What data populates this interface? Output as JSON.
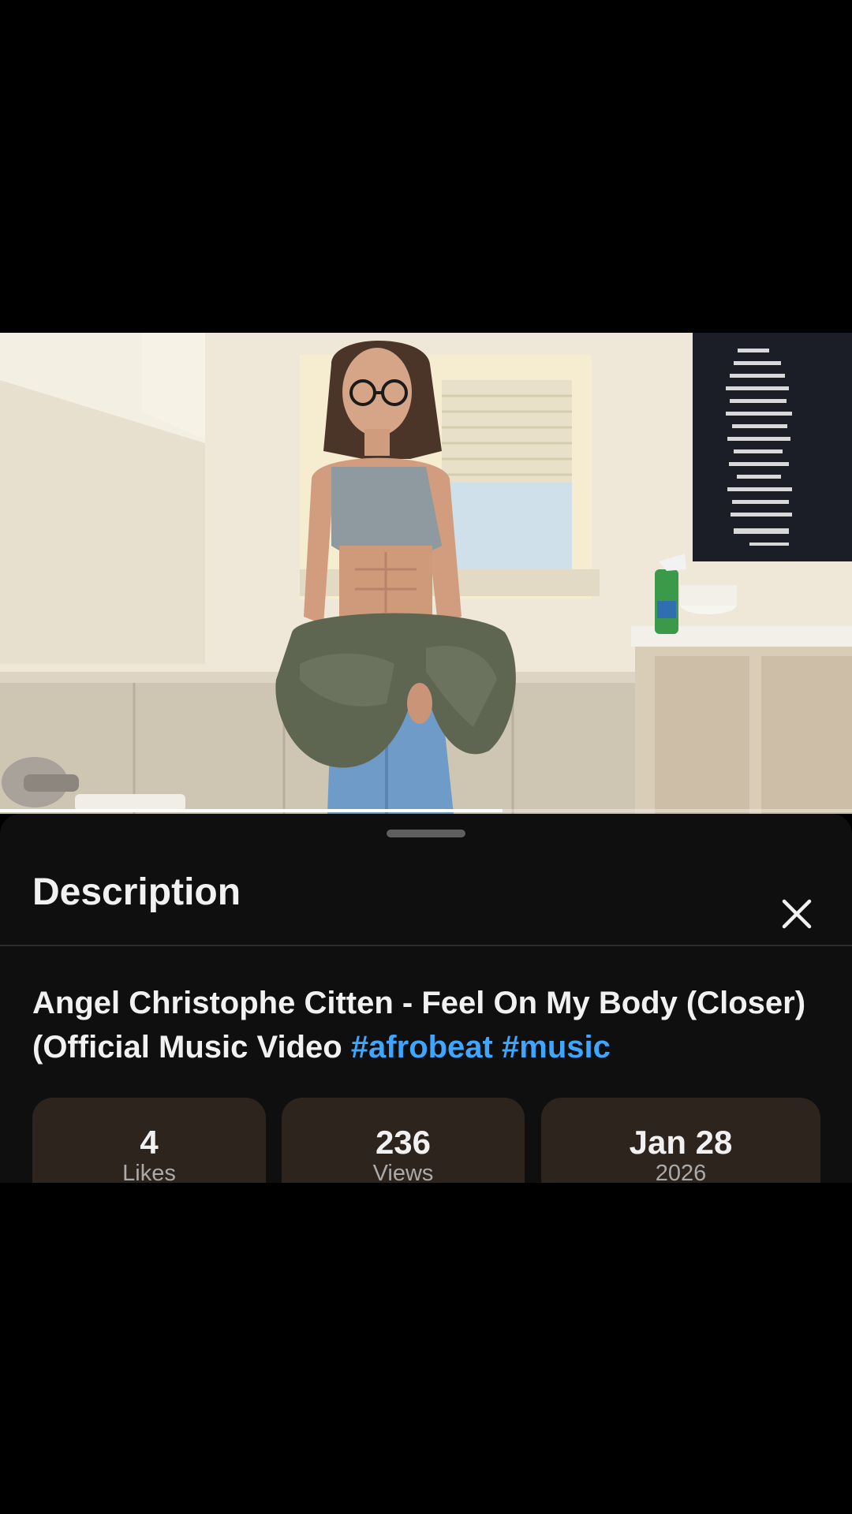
{
  "video": {
    "progress": 0.59,
    "colors": {
      "wall": "#efe8d8",
      "tile": "#c9bfae",
      "sign": "#1b1e26",
      "top": "#8f9aa0",
      "pants": "#5e6652",
      "jeans": "#6f9bc8"
    }
  },
  "sheet": {
    "title": "Description",
    "close_icon": "close-icon"
  },
  "video_info": {
    "title": "Angel Christophe Citten - Feel On My Body (Closer) (Official Music Video",
    "hashtags": [
      "#afrobeat",
      "#music"
    ]
  },
  "stats": {
    "likes": {
      "value": "4",
      "label": "Likes"
    },
    "views": {
      "value": "236",
      "label": "Views"
    },
    "date": {
      "value": "Jan 28",
      "label": "2026"
    }
  },
  "colors": {
    "sheet_bg": "#0f0f0f",
    "card_bg": "#2d241e",
    "hashtag": "#3ea6ff",
    "text": "#f1f1f1",
    "muted": "#aaaaaa"
  }
}
